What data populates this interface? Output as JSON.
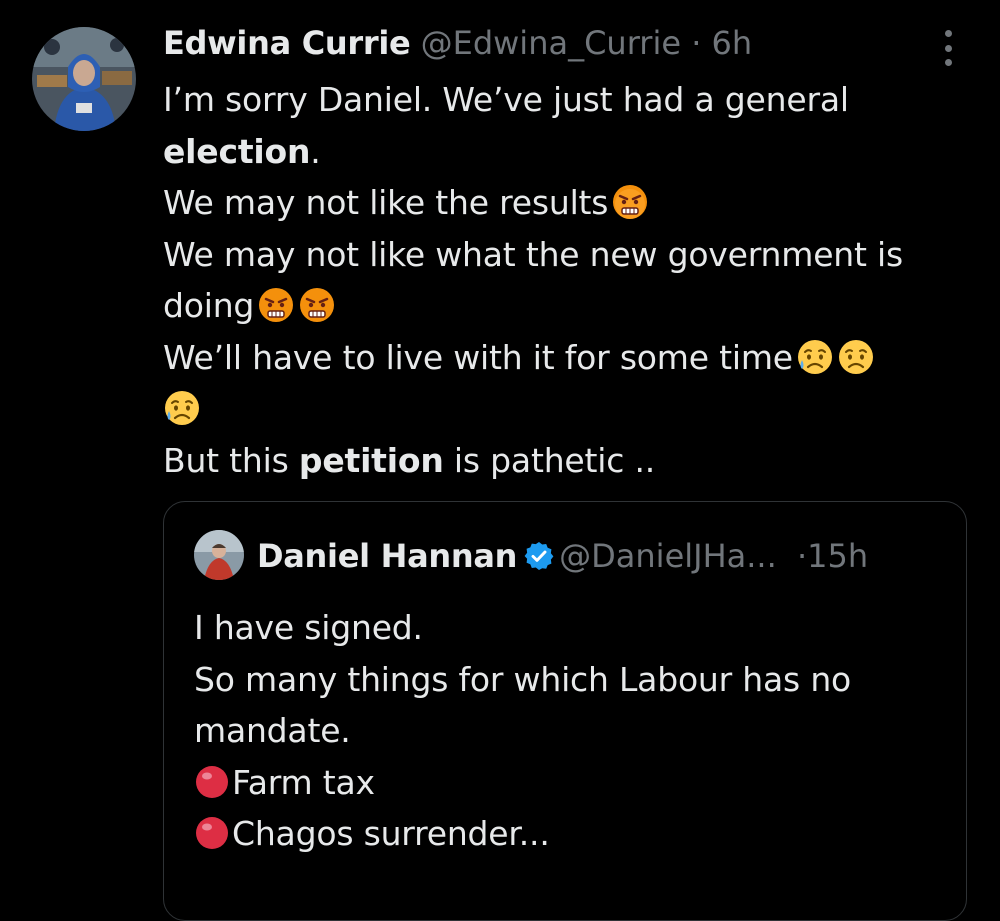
{
  "tweet": {
    "author_name": "Edwina Currie",
    "handle": "@Edwina_Currie",
    "separator": "·",
    "time": "6h",
    "avatar_icon": "profile-photo",
    "lines": {
      "l1": "I’m sorry Daniel. We’ve just had a general",
      "l2_bold": "election",
      "l2_rest": ".",
      "l3": "We may not like the results",
      "l4": "We may not like what the new government is",
      "l5": "doing",
      "l6": "We’ll have to live with it for some time",
      "l8_a": "But this ",
      "l8_bold": "petition",
      "l8_b": " is pathetic .."
    },
    "emoji": {
      "angry": "angry-face-icon",
      "sad": "sad-but-relieved-face-icon"
    },
    "more_icon": "more-options-icon"
  },
  "quoted": {
    "author_name": "Daniel Hannan",
    "verified_icon": "verified-badge-icon",
    "handle": "@DanielJHa...",
    "separator": "·",
    "time": "15h",
    "lines": {
      "l1": "I have signed.",
      "l2": "So many things for which Labour has no",
      "l3": "mandate.",
      "l4": "Farm tax",
      "l5": "Chagos surrender..."
    },
    "bullet_icon": "red-circle-icon"
  },
  "colors": {
    "background": "#000000",
    "text": "#e7e9ea",
    "muted": "#71767b",
    "border": "#2f3336",
    "verified": "#1d9bf0",
    "bullet": "#dd2e44"
  }
}
